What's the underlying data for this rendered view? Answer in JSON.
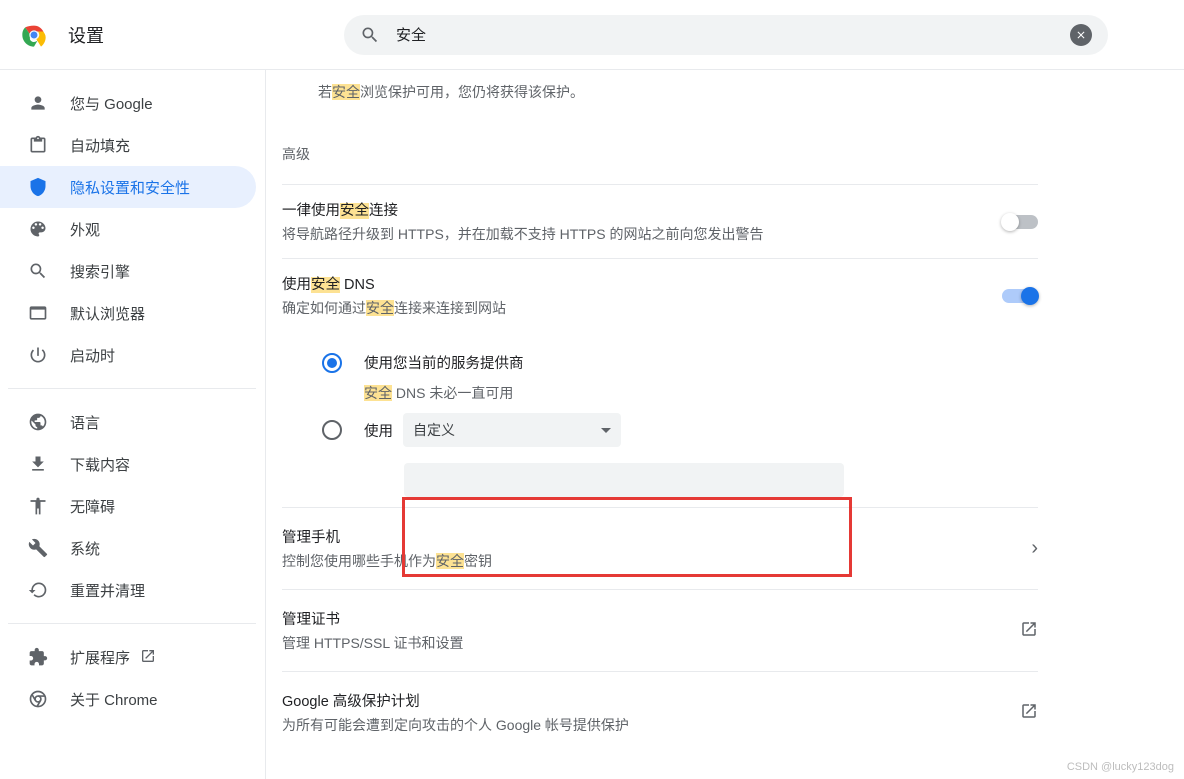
{
  "header": {
    "title": "设置",
    "search_value": "安全"
  },
  "sidebar": {
    "items": [
      {
        "label": "您与 Google"
      },
      {
        "label": "自动填充"
      },
      {
        "label": "隐私设置和安全性"
      },
      {
        "label": "外观"
      },
      {
        "label": "搜索引擎"
      },
      {
        "label": "默认浏览器"
      },
      {
        "label": "启动时"
      },
      {
        "label": "语言"
      },
      {
        "label": "下载内容"
      },
      {
        "label": "无障碍"
      },
      {
        "label": "系统"
      },
      {
        "label": "重置并清理"
      },
      {
        "label": "扩展程序"
      },
      {
        "label": "关于 Chrome"
      }
    ]
  },
  "main": {
    "top_desc_prefix": "若",
    "top_desc_hl": "安全",
    "top_desc_suffix": "浏览保护可用，您仍将获得该保护。",
    "advanced_label": "高级",
    "https": {
      "title_prefix": "一律使用",
      "title_hl": "安全",
      "title_suffix": "连接",
      "sub": "将导航路径升级到 HTTPS，并在加载不支持 HTTPS 的网站之前向您发出警告",
      "enabled": false
    },
    "dns": {
      "title_prefix": "使用",
      "title_hl": "安全",
      "title_suffix": " DNS",
      "sub_prefix": "确定如何通过",
      "sub_hl": "安全",
      "sub_suffix": "连接来连接到网站",
      "enabled": true,
      "opt1_label": "使用您当前的服务提供商",
      "opt1_sub_hl": "安全",
      "opt1_sub_suffix": " DNS 未必一直可用",
      "opt2_label": "使用",
      "dropdown_label": "自定义"
    },
    "phone": {
      "title": "管理手机",
      "sub_prefix": "控制您使用哪些手机作为",
      "sub_hl": "安全",
      "sub_suffix": "密钥"
    },
    "certs": {
      "title": "管理证书",
      "sub": "管理 HTTPS/SSL 证书和设置"
    },
    "gap": {
      "title": "Google 高级保护计划",
      "sub": "为所有可能会遭到定向攻击的个人 Google 帐号提供保护"
    }
  },
  "watermark": "CSDN @lucky123dog"
}
